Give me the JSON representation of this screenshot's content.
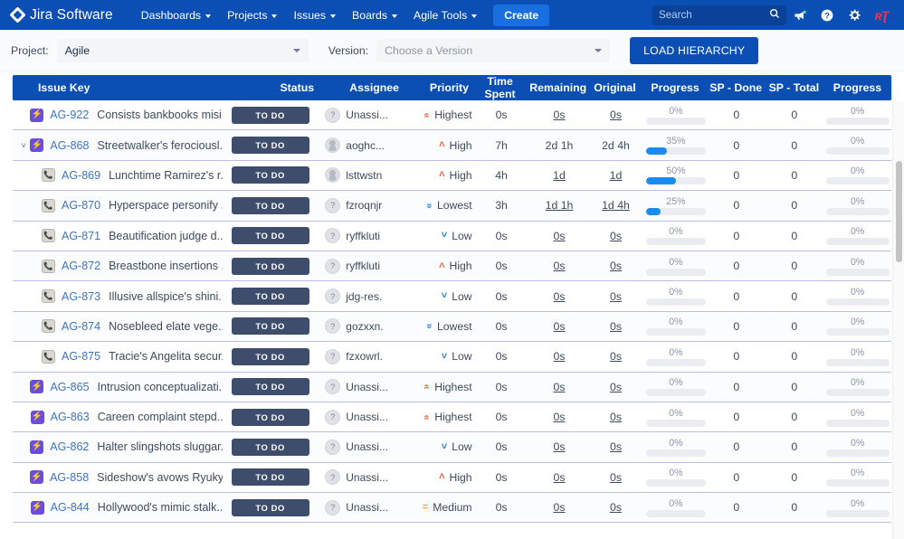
{
  "topnav": {
    "brand": "Jira Software",
    "brand_icon": "jira-diamond-icon",
    "items": [
      {
        "label": "Dashboards"
      },
      {
        "label": "Projects"
      },
      {
        "label": "Issues"
      },
      {
        "label": "Boards"
      },
      {
        "label": "Agile Tools"
      }
    ],
    "create_label": "Create",
    "search_placeholder": "Search",
    "search_value": "",
    "icons": [
      {
        "name": "megaphone-icon",
        "glyph": "📢"
      },
      {
        "name": "help-icon",
        "glyph": "?"
      },
      {
        "name": "gear-icon",
        "glyph": "⚙"
      },
      {
        "name": "user-avatar-icon",
        "glyph": "ʀƨ"
      }
    ]
  },
  "toolbar": {
    "project_label": "Project:",
    "project_value": "Agile",
    "version_label": "Version:",
    "version_placeholder": "Choose a Version",
    "load_hierarchy_label": "LOAD HIERARCHY"
  },
  "table": {
    "columns": [
      "Issue Key",
      "Status",
      "Assignee",
      "Priority",
      "Time Spent",
      "Remaining",
      "Original",
      "Progress",
      "SP - Done",
      "SP - Total",
      "Progress"
    ],
    "rows": [
      {
        "twisty": "",
        "type": "epic",
        "indent": 0,
        "key": "AG-922",
        "summary": "Consists bankbooks misi...",
        "status": "TO DO",
        "avatar": "question",
        "assignee": "Unassi...",
        "priority": "Highest",
        "prio_icon": "»",
        "spent": "0s",
        "remaining": "0s",
        "remaining_link": true,
        "original": "0s",
        "original_link": true,
        "progress": 0,
        "progress_label": "0%",
        "sp_done": "0",
        "sp_total": "0",
        "sp_progress": 0,
        "sp_progress_label": "0%"
      },
      {
        "twisty": "˅",
        "type": "epic",
        "indent": 0,
        "key": "AG-868",
        "summary": "Streetwalker's ferociousl...",
        "status": "TO DO",
        "avatar": "person",
        "assignee": "aoghc...",
        "priority": "High",
        "prio_icon": "˄",
        "spent": "7h",
        "remaining": "2d 1h",
        "remaining_link": false,
        "original": "2d 4h",
        "original_link": false,
        "progress": 35,
        "progress_label": "35%",
        "sp_done": "0",
        "sp_total": "0",
        "sp_progress": 0,
        "sp_progress_label": "0%"
      },
      {
        "twisty": "",
        "type": "sub",
        "indent": 1,
        "key": "AG-869",
        "summary": "Lunchtime Ramirez's r...",
        "status": "TO DO",
        "avatar": "person",
        "assignee": "lsttwstn",
        "priority": "High",
        "prio_icon": "˄",
        "spent": "4h",
        "remaining": "1d",
        "remaining_link": true,
        "original": "1d",
        "original_link": true,
        "progress": 50,
        "progress_label": "50%",
        "sp_done": "0",
        "sp_total": "0",
        "sp_progress": 0,
        "sp_progress_label": "0%"
      },
      {
        "twisty": "",
        "type": "sub",
        "indent": 1,
        "key": "AG-870",
        "summary": "Hyperspace personify ...",
        "status": "TO DO",
        "avatar": "question",
        "assignee": "fzroqnjr",
        "priority": "Lowest",
        "prio_icon": "«",
        "spent": "3h",
        "remaining": "1d 1h",
        "remaining_link": true,
        "original": "1d 4h",
        "original_link": true,
        "progress": 25,
        "progress_label": "25%",
        "sp_done": "0",
        "sp_total": "0",
        "sp_progress": 0,
        "sp_progress_label": "0%"
      },
      {
        "twisty": "",
        "type": "sub",
        "indent": 1,
        "key": "AG-871",
        "summary": "Beautification judge d...",
        "status": "TO DO",
        "avatar": "question",
        "assignee": "ryffkluti",
        "priority": "Low",
        "prio_icon": "˅",
        "spent": "0s",
        "remaining": "0s",
        "remaining_link": true,
        "original": "0s",
        "original_link": true,
        "progress": 0,
        "progress_label": "0%",
        "sp_done": "0",
        "sp_total": "0",
        "sp_progress": 0,
        "sp_progress_label": "0%"
      },
      {
        "twisty": "",
        "type": "sub",
        "indent": 1,
        "key": "AG-872",
        "summary": "Breastbone insertions ...",
        "status": "TO DO",
        "avatar": "question",
        "assignee": "ryffkluti",
        "priority": "High",
        "prio_icon": "˄",
        "spent": "0s",
        "remaining": "0s",
        "remaining_link": true,
        "original": "0s",
        "original_link": true,
        "progress": 0,
        "progress_label": "0%",
        "sp_done": "0",
        "sp_total": "0",
        "sp_progress": 0,
        "sp_progress_label": "0%"
      },
      {
        "twisty": "",
        "type": "sub",
        "indent": 1,
        "key": "AG-873",
        "summary": "Illusive allspice's shini...",
        "status": "TO DO",
        "avatar": "question",
        "assignee": "jdg-res.",
        "priority": "Low",
        "prio_icon": "˅",
        "spent": "0s",
        "remaining": "0s",
        "remaining_link": true,
        "original": "0s",
        "original_link": true,
        "progress": 0,
        "progress_label": "0%",
        "sp_done": "0",
        "sp_total": "0",
        "sp_progress": 0,
        "sp_progress_label": "0%"
      },
      {
        "twisty": "",
        "type": "sub",
        "indent": 1,
        "key": "AG-874",
        "summary": "Nosebleed elate vege...",
        "status": "TO DO",
        "avatar": "question",
        "assignee": "gozxxn.",
        "priority": "Lowest",
        "prio_icon": "«",
        "spent": "0s",
        "remaining": "0s",
        "remaining_link": true,
        "original": "0s",
        "original_link": true,
        "progress": 0,
        "progress_label": "0%",
        "sp_done": "0",
        "sp_total": "0",
        "sp_progress": 0,
        "sp_progress_label": "0%"
      },
      {
        "twisty": "",
        "type": "sub",
        "indent": 1,
        "key": "AG-875",
        "summary": "Tracie's Angelita secur...",
        "status": "TO DO",
        "avatar": "question",
        "assignee": "fzxowrl.",
        "priority": "Low",
        "prio_icon": "˅",
        "spent": "0s",
        "remaining": "0s",
        "remaining_link": true,
        "original": "0s",
        "original_link": true,
        "progress": 0,
        "progress_label": "0%",
        "sp_done": "0",
        "sp_total": "0",
        "sp_progress": 0,
        "sp_progress_label": "0%"
      },
      {
        "twisty": "",
        "type": "epic",
        "indent": 0,
        "key": "AG-865",
        "summary": "Intrusion conceptualizati...",
        "status": "TO DO",
        "avatar": "question",
        "assignee": "Unassi...",
        "priority": "Highest",
        "prio_icon": "»",
        "spent": "0s",
        "remaining": "0s",
        "remaining_link": true,
        "original": "0s",
        "original_link": true,
        "progress": 0,
        "progress_label": "0%",
        "sp_done": "0",
        "sp_total": "0",
        "sp_progress": 0,
        "sp_progress_label": "0%"
      },
      {
        "twisty": "",
        "type": "epic",
        "indent": 0,
        "key": "AG-863",
        "summary": "Careen complaint stepd...",
        "status": "TO DO",
        "avatar": "question",
        "assignee": "Unassi...",
        "priority": "Highest",
        "prio_icon": "»",
        "spent": "0s",
        "remaining": "0s",
        "remaining_link": true,
        "original": "0s",
        "original_link": true,
        "progress": 0,
        "progress_label": "0%",
        "sp_done": "0",
        "sp_total": "0",
        "sp_progress": 0,
        "sp_progress_label": "0%"
      },
      {
        "twisty": "",
        "type": "epic",
        "indent": 0,
        "key": "AG-862",
        "summary": "Halter slingshots sluggar...",
        "status": "TO DO",
        "avatar": "question",
        "assignee": "Unassi...",
        "priority": "Low",
        "prio_icon": "˅",
        "spent": "0s",
        "remaining": "0s",
        "remaining_link": true,
        "original": "0s",
        "original_link": true,
        "progress": 0,
        "progress_label": "0%",
        "sp_done": "0",
        "sp_total": "0",
        "sp_progress": 0,
        "sp_progress_label": "0%"
      },
      {
        "twisty": "",
        "type": "epic",
        "indent": 0,
        "key": "AG-858",
        "summary": "Sideshow's avows Ryuky...",
        "status": "TO DO",
        "avatar": "question",
        "assignee": "Unassi...",
        "priority": "High",
        "prio_icon": "˄",
        "spent": "0s",
        "remaining": "0s",
        "remaining_link": true,
        "original": "0s",
        "original_link": true,
        "progress": 0,
        "progress_label": "0%",
        "sp_done": "0",
        "sp_total": "0",
        "sp_progress": 0,
        "sp_progress_label": "0%"
      },
      {
        "twisty": "",
        "type": "epic",
        "indent": 0,
        "key": "AG-844",
        "summary": "Hollywood's mimic stalk...",
        "status": "TO DO",
        "avatar": "question",
        "assignee": "Unassi...",
        "priority": "Medium",
        "prio_icon": "=",
        "spent": "0s",
        "remaining": "0s",
        "remaining_link": true,
        "original": "0s",
        "original_link": true,
        "progress": 0,
        "progress_label": "0%",
        "sp_done": "0",
        "sp_total": "0",
        "sp_progress": 0,
        "sp_progress_label": "0%"
      }
    ]
  },
  "colors": {
    "nav_blue": "#0b4fb4",
    "create_blue": "#1a6fe0",
    "status_badge": "#3d4d6b",
    "progress_fill": "#1a8cf0",
    "epic_purple": "#6b4ddb",
    "link_blue": "#3b73c4"
  }
}
